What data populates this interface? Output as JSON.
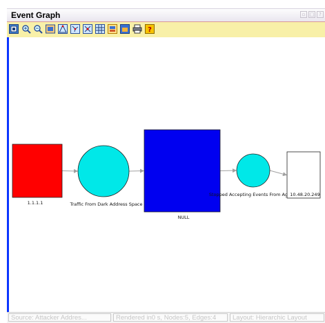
{
  "window": {
    "title": "Event Graph",
    "controls": [
      "minimize-icon",
      "maximize-icon",
      "help-icon"
    ]
  },
  "toolbar": {
    "buttons": [
      {
        "name": "fit-to-window-icon"
      },
      {
        "name": "zoom-in-icon"
      },
      {
        "name": "zoom-out-icon"
      },
      {
        "name": "pan-icon"
      },
      {
        "name": "hierarchic-layout-icon"
      },
      {
        "name": "tree-layout-icon"
      },
      {
        "name": "organic-layout-icon"
      },
      {
        "name": "grid-layout-icon"
      },
      {
        "name": "overview-icon"
      },
      {
        "name": "export-image-icon"
      },
      {
        "name": "print-icon"
      },
      {
        "name": "help-icon"
      }
    ]
  },
  "graph": {
    "nodes": [
      {
        "id": "n1",
        "shape": "rect",
        "color": "#ff0000",
        "label": "1.1.1.1"
      },
      {
        "id": "n2",
        "shape": "circle",
        "color": "#00e8e8",
        "label": "Traffic From Dark Address Space"
      },
      {
        "id": "n3",
        "shape": "rect",
        "color": "#0000f0",
        "label": "NULL"
      },
      {
        "id": "n4",
        "shape": "circle",
        "color": "#00e8e8",
        "label": "Stopped Accepting Events From Agents"
      },
      {
        "id": "n5",
        "shape": "rect",
        "color": "#ffffff",
        "label": "10.48.20.249"
      }
    ],
    "edges": [
      {
        "from": "n1",
        "to": "n2"
      },
      {
        "from": "n2",
        "to": "n3"
      },
      {
        "from": "n3",
        "to": "n4"
      },
      {
        "from": "n4",
        "to": "n5"
      }
    ],
    "edge_color": "#a0a0a0"
  },
  "statusbar": {
    "source": "Source: Attacker Addres...",
    "rendered": "Rendered in0 s, Nodes:5, Edges:4",
    "layout": "Layout: Hierarchic Layout"
  }
}
